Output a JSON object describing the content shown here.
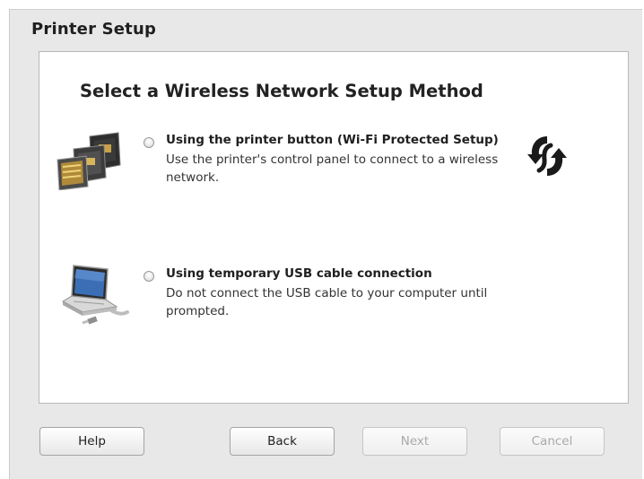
{
  "window": {
    "title": "Printer Setup"
  },
  "panel": {
    "heading": "Select a Wireless Network Setup Method",
    "options": [
      {
        "title": "Using the printer button (Wi-Fi Protected Setup)",
        "description": "Use the printer's control panel to connect to a wireless network.",
        "selected": false,
        "illustration_icon": "printer-control-panel-icon",
        "badge_icon": "wps-icon"
      },
      {
        "title": "Using temporary USB cable connection",
        "description": "Do not connect the USB cable to your computer until prompted.",
        "selected": false,
        "illustration_icon": "laptop-usb-icon"
      }
    ]
  },
  "buttons": {
    "help": "Help",
    "back": "Back",
    "next": "Next",
    "cancel": "Cancel",
    "next_enabled": false,
    "cancel_enabled": false
  },
  "colors": {
    "window_background": "#e8e8e8",
    "panel_background": "#ffffff",
    "disabled_text": "#a9a9a9"
  }
}
